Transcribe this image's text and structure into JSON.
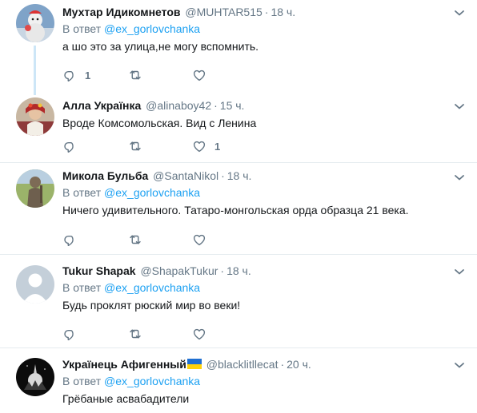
{
  "colors": {
    "link": "#1da1f2",
    "muted": "#657786",
    "text": "#14171a",
    "thread_line": "#cde6f7",
    "divider": "#e6ecf0"
  },
  "reply_prefix": "В ответ",
  "tweets": [
    {
      "name": "Мухтар Идикомнетов",
      "handle": "@MUHTAR515",
      "time": "18 ч.",
      "mention": "@ex_gorlovchanka",
      "text": "а шо это за улица,не могу вспомнить.",
      "reply_count": "1",
      "retweet_count": "",
      "like_count": ""
    },
    {
      "name": "Алла Українка",
      "handle": "@alinaboy42",
      "time": "15 ч.",
      "mention": "",
      "text": "Вроде Комсомольская. Вид с Ленина",
      "reply_count": "",
      "retweet_count": "",
      "like_count": "1"
    },
    {
      "name": "Микола Бульба",
      "handle": "@SantaNikol",
      "time": "18 ч.",
      "mention": "@ex_gorlovchanka",
      "text": "Ничего удивительного. Татаро-монгольская орда образца 21 века.",
      "reply_count": "",
      "retweet_count": "",
      "like_count": ""
    },
    {
      "name": "Tukur Shapak",
      "handle": "@ShapakTukur",
      "time": "18 ч.",
      "mention": "@ex_gorlovchanka",
      "text": "Будь проклят рюский мир во веки!",
      "reply_count": "",
      "retweet_count": "",
      "like_count": ""
    },
    {
      "name": "Українець Афигенный",
      "handle": "@blacklitllecat",
      "time": "20 ч.",
      "mention": "@ex_gorlovchanka",
      "text": "Грёбаные асвабадители",
      "reply_count": "",
      "retweet_count": "",
      "like_count": ""
    }
  ]
}
